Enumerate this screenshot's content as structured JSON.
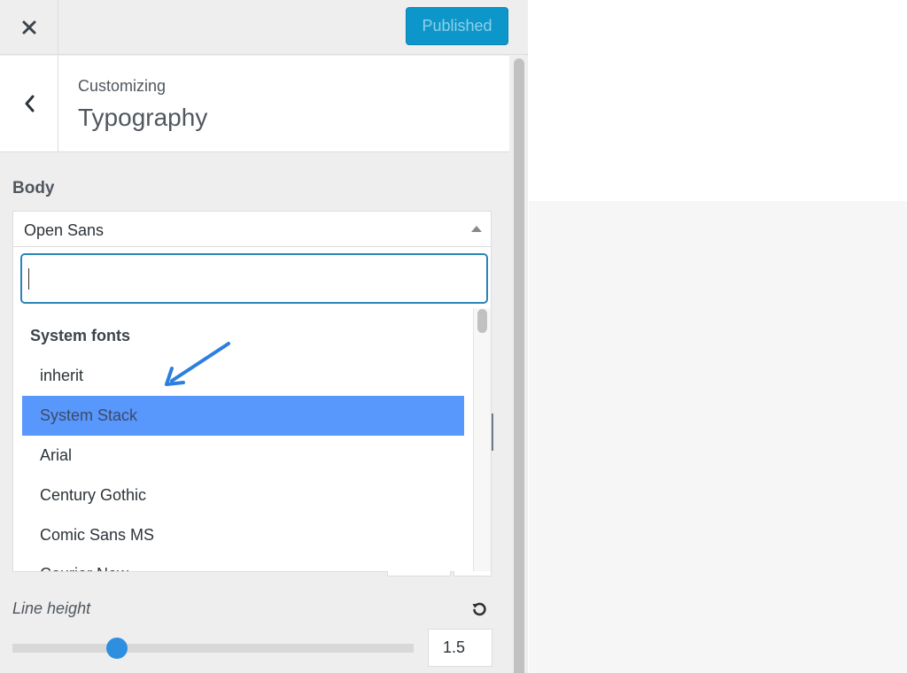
{
  "header": {
    "close_icon": "close-icon",
    "publish_label": "Published"
  },
  "section": {
    "back_icon": "chevron-left-icon",
    "customizing_label": "Customizing",
    "title": "Typography"
  },
  "body_font": {
    "label": "Body",
    "selected": "Open Sans",
    "search": {
      "value": "",
      "placeholder": ""
    },
    "dropdown": {
      "group_label": "System fonts",
      "options": [
        {
          "label": "inherit",
          "highlighted": false
        },
        {
          "label": "System Stack",
          "highlighted": true
        },
        {
          "label": "Arial",
          "highlighted": false
        },
        {
          "label": "Century Gothic",
          "highlighted": false
        },
        {
          "label": "Comic Sans MS",
          "highlighted": false
        },
        {
          "label": "Courier New",
          "highlighted": false
        }
      ]
    }
  },
  "line_height": {
    "label": "Line height",
    "reset_icon": "reset-icon",
    "value": "1.5",
    "slider_fraction": 0.26
  },
  "colors": {
    "accent": "#0d96c9",
    "highlight": "#5897fb",
    "slider_thumb": "#2f8fdf",
    "annotation_arrow": "#2a7fe0"
  }
}
